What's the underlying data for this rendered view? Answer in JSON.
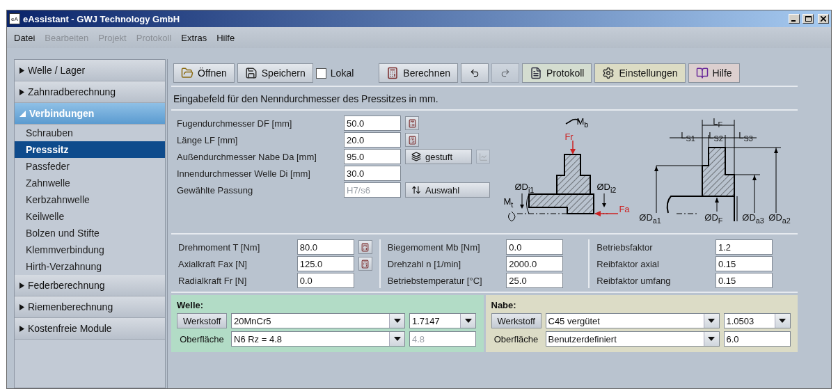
{
  "window": {
    "title": "eAssistant - GWJ Technology GmbH",
    "icon_text": "eA"
  },
  "menu": [
    {
      "label": "Datei",
      "disabled": false
    },
    {
      "label": "Bearbeiten",
      "disabled": true
    },
    {
      "label": "Projekt",
      "disabled": true
    },
    {
      "label": "Protokoll",
      "disabled": true
    },
    {
      "label": "Extras",
      "disabled": false
    },
    {
      "label": "Hilfe",
      "disabled": false
    }
  ],
  "sidebar": [
    {
      "label": "Welle / Lager",
      "expanded": false
    },
    {
      "label": "Zahnradberechnung",
      "expanded": false
    },
    {
      "label": "Verbindungen",
      "expanded": true,
      "children": [
        {
          "label": "Schrauben",
          "selected": false
        },
        {
          "label": "Presssitz",
          "selected": true
        },
        {
          "label": "Passfeder",
          "selected": false
        },
        {
          "label": "Zahnwelle",
          "selected": false
        },
        {
          "label": "Kerbzahnwelle",
          "selected": false
        },
        {
          "label": "Keilwelle",
          "selected": false
        },
        {
          "label": "Bolzen und Stifte",
          "selected": false
        },
        {
          "label": "Klemmverbindung",
          "selected": false
        },
        {
          "label": "Hirth-Verzahnung",
          "selected": false
        }
      ]
    },
    {
      "label": "Federberechnung",
      "expanded": false
    },
    {
      "label": "Riemenberechnung",
      "expanded": false
    },
    {
      "label": "Kostenfreie Module",
      "expanded": false
    }
  ],
  "toolbar": [
    {
      "kind": "open",
      "label": "Öffnen",
      "disabled": false
    },
    {
      "kind": "save",
      "label": "Speichern",
      "disabled": false
    },
    {
      "kind": "checkbox",
      "label": "Lokal",
      "checked": false
    },
    {
      "kind": "calculate",
      "label": "Berechnen",
      "disabled": false
    },
    {
      "kind": "undo",
      "disabled": false
    },
    {
      "kind": "redo",
      "disabled": true
    },
    {
      "kind": "report",
      "label": "Protokoll",
      "disabled": false,
      "color": "#d4ddd0"
    },
    {
      "kind": "settings",
      "label": "Einstellungen",
      "disabled": false,
      "color": "#dcdcc4"
    },
    {
      "kind": "help",
      "label": "Hilfe",
      "disabled": false,
      "color": "#dccfcf"
    }
  ],
  "hint": "Eingabefeld für den Nenndurchmesser des Pressitzes in mm.",
  "geometry": [
    {
      "label": "Fugendurchmesser DF [mm]",
      "value": "50.0",
      "disabled": false,
      "kind": "calc"
    },
    {
      "label": "Länge LF [mm]",
      "value": "20.0",
      "disabled": false,
      "kind": "calc"
    },
    {
      "label": "Außendurchmesser Nabe Da [mm]",
      "value": "95.0",
      "disabled": false,
      "kind": "stepped",
      "button": "gestuft"
    },
    {
      "label": "Innendurchmesser Welle Di [mm]",
      "value": "30.0",
      "disabled": false,
      "kind": "plain"
    },
    {
      "label": "Gewählte Passung",
      "value": "H7/s6",
      "disabled": true,
      "kind": "select",
      "button": "Auswahl"
    }
  ],
  "diagram_left": [
    {
      "text": "M$_{b}$",
      "color": "#000000"
    },
    {
      "text": "Fr",
      "color": "#cc2222"
    },
    {
      "text": "ØD$_{i1}$",
      "color": "#000000"
    },
    {
      "text": "ØD$_{i2}$",
      "color": "#000000"
    },
    {
      "text": "M$_{t}$",
      "color": "#000000"
    },
    {
      "text": "Fa",
      "color": "#cc2222"
    }
  ],
  "diagram_right": [
    {
      "text": "L$_{F}$"
    },
    {
      "text": "L$_{S1}$"
    },
    {
      "text": "L$_{S2}$"
    },
    {
      "text": "L$_{S3}$"
    },
    {
      "text": "ØD$_{a1}$"
    },
    {
      "text": "ØD$_{F}$"
    },
    {
      "text": "ØD$_{a3}$"
    },
    {
      "text": "ØD$_{a2}$"
    }
  ],
  "loads": [
    [
      {
        "label": "Drehmoment T [Nm]",
        "value": "80.0",
        "calc": true
      },
      {
        "label": "Axialkraft Fax [N]",
        "value": "125.0",
        "calc": true
      },
      {
        "label": "Radialkraft Fr [N]",
        "value": "0.0",
        "calc": false
      }
    ],
    [
      {
        "label": "Biegemoment Mb [Nm]",
        "value": "0.0",
        "calc": false
      },
      {
        "label": "Drehzahl n [1/min]",
        "value": "2000.0",
        "calc": false
      },
      {
        "label": "Betriebstemperatur [°C]",
        "value": "25.0",
        "calc": false
      }
    ],
    [
      {
        "label": "Betriebsfaktor",
        "value": "1.2",
        "calc": false
      },
      {
        "label": "Reibfaktor axial",
        "value": "0.15",
        "calc": false
      },
      {
        "label": "Reibfaktor umfang",
        "value": "0.15",
        "calc": false
      }
    ]
  ],
  "materials": [
    {
      "title": "Welle:",
      "color": "#b2dcc6",
      "material_button": "Werkstoff",
      "material": "20MnCr5",
      "code": "1.7147",
      "surface_label": "Oberfläche",
      "surface": "N6 Rz = 4.8",
      "roughness": "4.8",
      "roughness_disabled": true
    },
    {
      "title": "Nabe:",
      "color": "#dcdcc6",
      "material_button": "Werkstoff",
      "material": "C45 vergütet",
      "code": "1.0503",
      "surface_label": "Oberfläche",
      "surface": "Benutzerdefiniert",
      "roughness": "6.0",
      "roughness_disabled": false
    }
  ]
}
